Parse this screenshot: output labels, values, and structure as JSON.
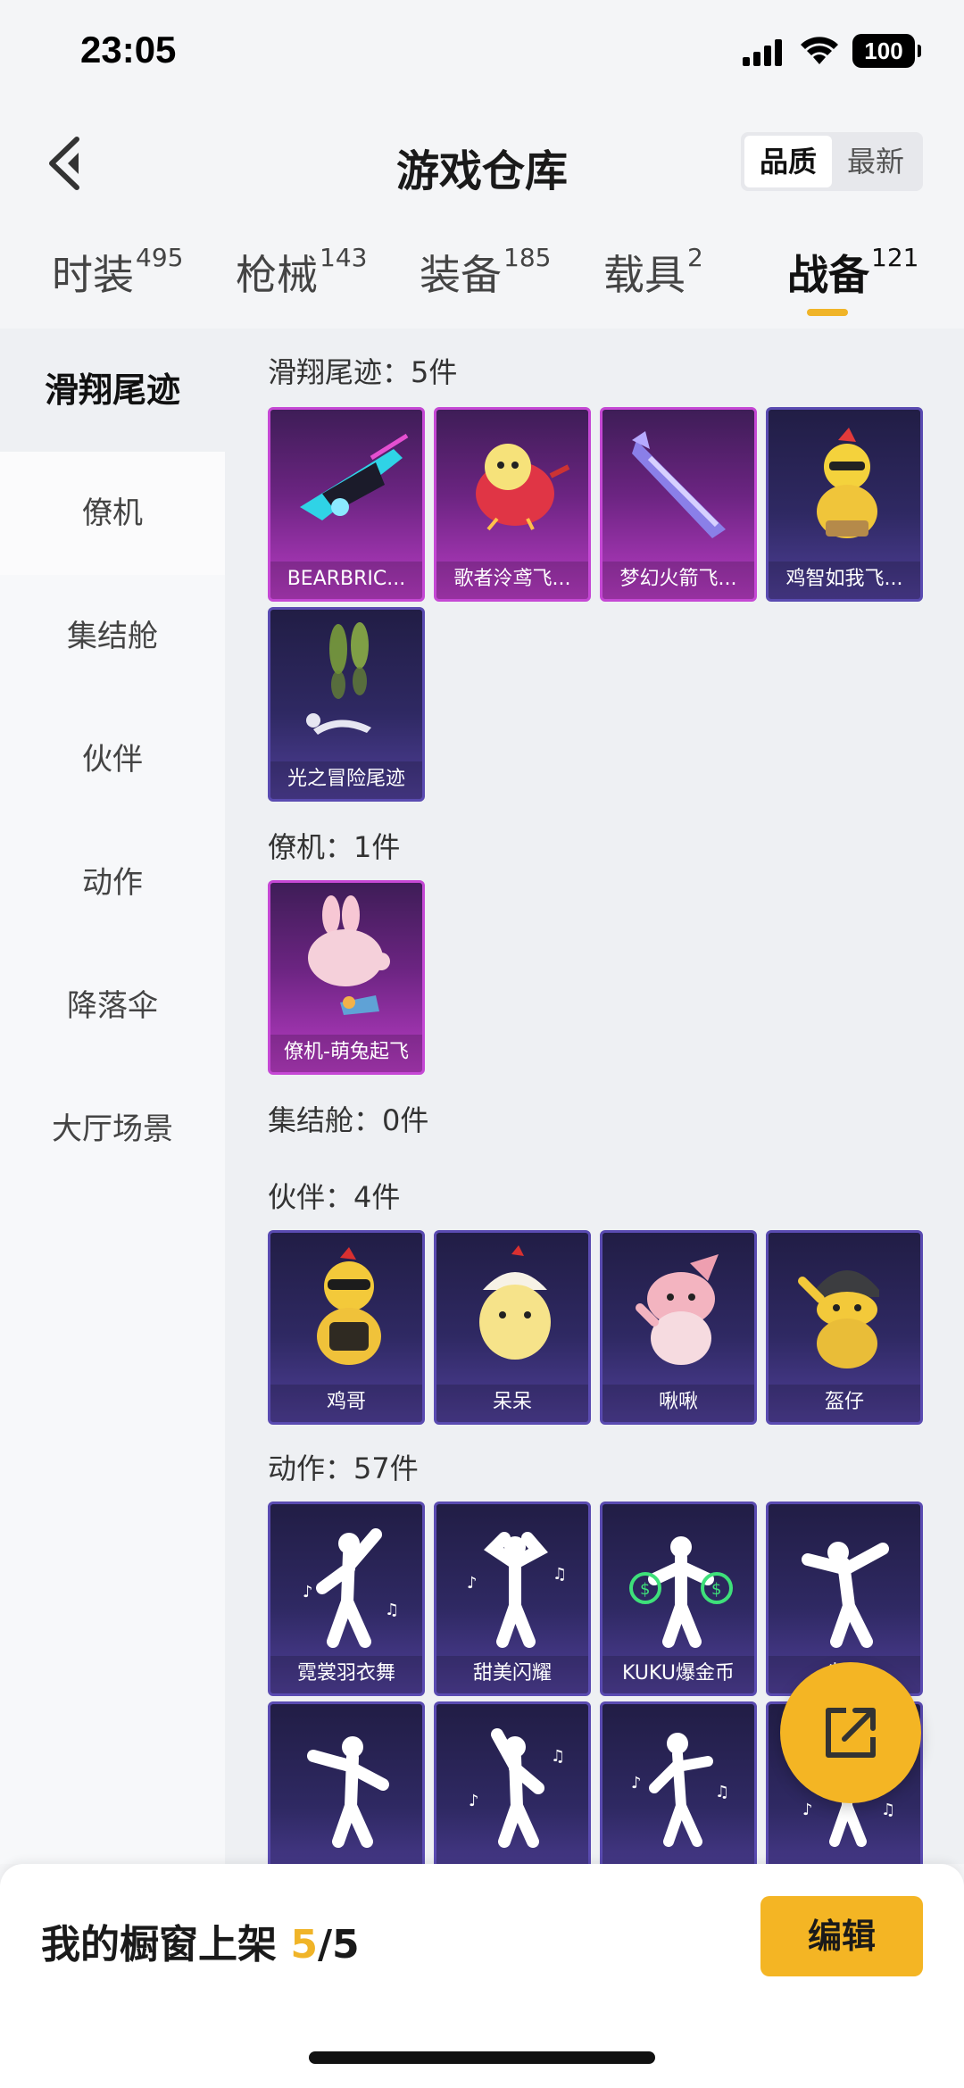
{
  "status_bar": {
    "time": "23:05",
    "battery": "100"
  },
  "header": {
    "title": "游戏仓库",
    "sort_options": [
      "品质",
      "最新"
    ],
    "active_sort": "品质"
  },
  "tabs": [
    {
      "label": "时装",
      "count": "495"
    },
    {
      "label": "枪械",
      "count": "143"
    },
    {
      "label": "装备",
      "count": "185"
    },
    {
      "label": "载具",
      "count": "2"
    },
    {
      "label": "战备",
      "count": "121",
      "active": true
    }
  ],
  "sidebar": [
    "滑翔尾迹",
    "僚机",
    "集结舱",
    "伙伴",
    "动作",
    "降落伞",
    "大厅场景"
  ],
  "sections": {
    "glide": {
      "title": "滑翔尾迹：5件",
      "items": [
        "BEARBRIC...",
        "歌者泠鸢飞...",
        "梦幻火箭飞...",
        "鸡智如我飞...",
        "光之冒险尾迹"
      ]
    },
    "wingman": {
      "title": "僚机：1件",
      "items": [
        "僚机-萌兔起飞"
      ]
    },
    "capsule": {
      "title": "集结舱：0件"
    },
    "partner": {
      "title": "伙伴：4件",
      "items": [
        "鸡哥",
        "呆呆",
        "啾啾",
        "盔仔"
      ]
    },
    "emote": {
      "title": "动作：57件",
      "items": [
        "霓裳羽衣舞",
        "甜美闪耀",
        "KUKU爆金币",
        "尖..."
      ]
    }
  },
  "bottom_bar": {
    "label": "我的橱窗上架 ",
    "current": "5",
    "total": "/5",
    "edit": "编辑"
  },
  "colors": {
    "accent": "#f4b524",
    "pink_card": "#b83cc4",
    "purple_card": "#4f3f98"
  }
}
